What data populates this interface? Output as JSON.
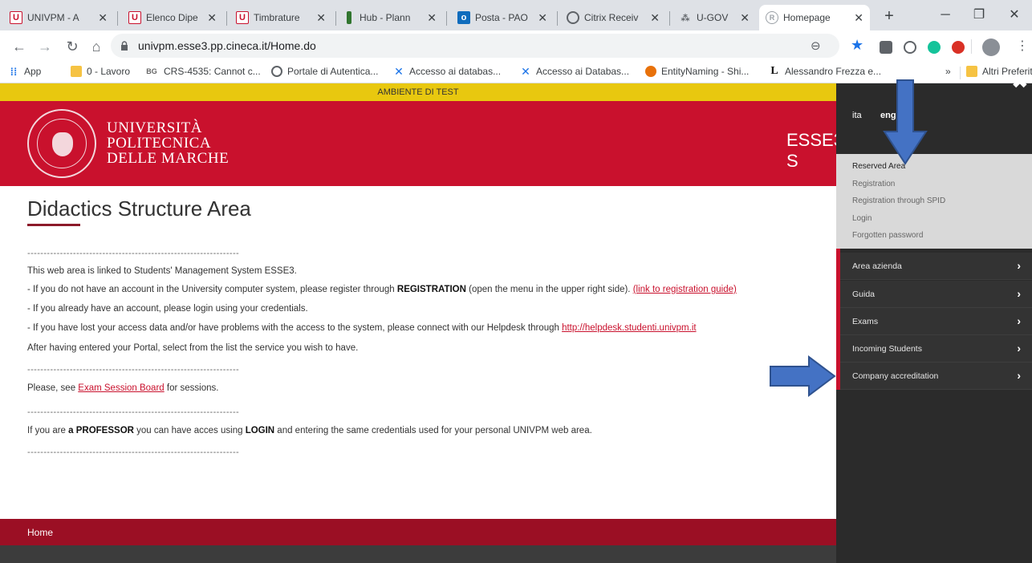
{
  "browser": {
    "tabs": [
      {
        "title": "UNIVPM - A",
        "favicon": "univpm-u-icon"
      },
      {
        "title": "Elenco Dipe",
        "favicon": "univpm-u-icon"
      },
      {
        "title": "Timbrature",
        "favicon": "univpm-u-icon"
      },
      {
        "title": "Hub - Plann",
        "favicon": "planner-icon"
      },
      {
        "title": "Posta - PAO",
        "favicon": "outlook-icon"
      },
      {
        "title": "Citrix Receiv",
        "favicon": "citrix-icon"
      },
      {
        "title": "U-GOV",
        "favicon": "ugov-icon"
      },
      {
        "title": "Homepage",
        "favicon": "cineca-icon"
      }
    ],
    "url": "univpm.esse3.pp.cineca.it/Home.do",
    "bookmarks": [
      {
        "label": "App"
      },
      {
        "label": "0 - Lavoro"
      },
      {
        "label": "CRS-4535: Cannot c..."
      },
      {
        "label": "Portale di Autentica..."
      },
      {
        "label": "Accesso ai databas..."
      },
      {
        "label": "Accesso ai Databas..."
      },
      {
        "label": "EntityNaming - Shi..."
      },
      {
        "label": "Alessandro Frezza e..."
      },
      {
        "label": "»"
      },
      {
        "label": "Altri Preferiti"
      }
    ]
  },
  "page": {
    "test_banner": "AMBIENTE DI TEST",
    "university": {
      "line1": "UNIVERSITÀ",
      "line2": "POLITECNICA",
      "line3": "DELLE MARCHE"
    },
    "system_title": "ESSE3 S",
    "title": "Didactics Structure Area",
    "separator": "-----------------------------------------------------------------",
    "paragraph1": "This web area is linked to Students' Management System ESSE3.",
    "bullet1_pre": "- If you do not have an account in the University computer system, please register through ",
    "bullet1_bold": "REGISTRATION",
    "bullet1_post": " (open the menu in the upper right side). ",
    "bullet1_link": "(link to registration guide)",
    "bullet2": "- If you already have an account, please login using your credentials.",
    "bullet3_pre": "- If you have lost your access data and/or have problems with the access to the system, please connect with our Helpdesk through ",
    "bullet3_link": "http://helpdesk.studenti.univpm.it",
    "paragraph2": "After having entered your Portal, select from the list the service you wish to have.",
    "exam_pre": "Please, see ",
    "exam_link": "Exam Session Board",
    "exam_post": " for sessions.",
    "prof_pre": "If you are ",
    "prof_bold": "a PROFESSOR",
    "prof_mid": " you can have acces using ",
    "prof_bold2": "LOGIN",
    "prof_post": " and entering the same credentials used for your personal UNIVPM web area.",
    "footer_home": "Home"
  },
  "sidemenu": {
    "lang_ita": "ita",
    "lang_eng": "eng",
    "reserved_title": "Reserved Area",
    "reserved_items": [
      "Registration",
      "Registration through SPID",
      "Login",
      "Forgotten password"
    ],
    "items": [
      "Area azienda",
      "Guida",
      "Exams",
      "Incoming Students",
      "Company accreditation"
    ]
  },
  "colors": {
    "brand_red": "#c9112d",
    "footer_red": "#9b0f24",
    "test_yellow": "#e8c80f",
    "menu_dark": "#2b2b2b",
    "annotation_arrow": "#4472c4"
  }
}
